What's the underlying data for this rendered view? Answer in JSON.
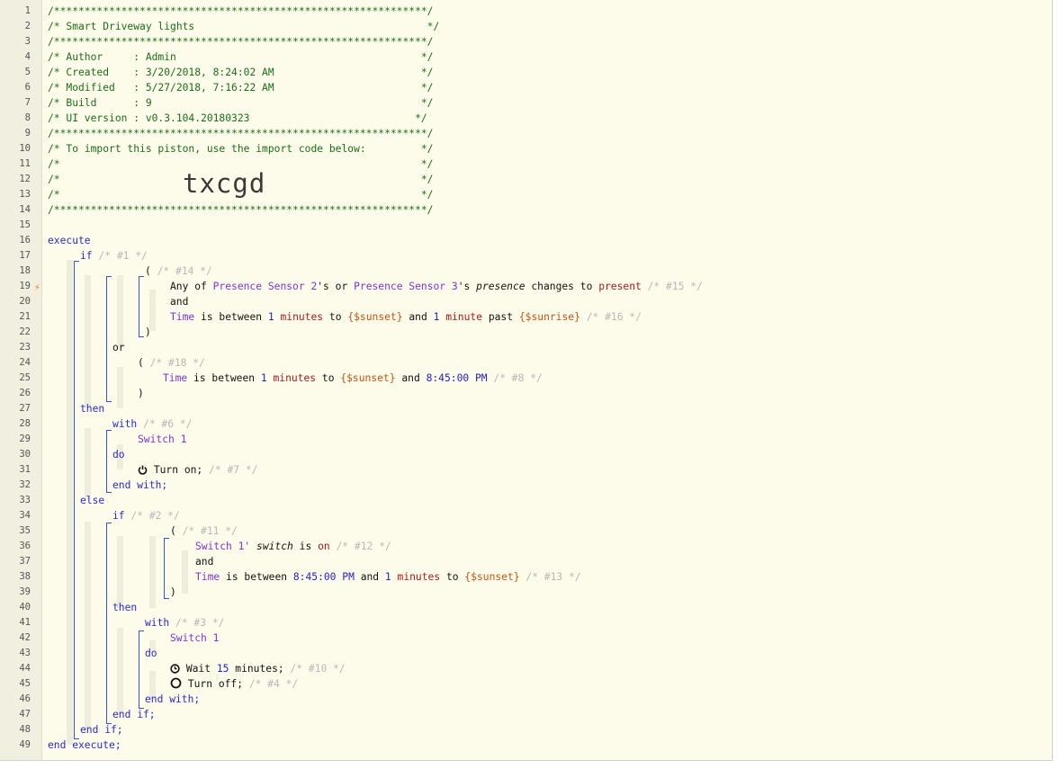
{
  "gutter": {
    "line_numbers": [
      "1",
      "2",
      "3",
      "4",
      "5",
      "6",
      "7",
      "8",
      "9",
      "10",
      "11",
      "12",
      "13",
      "14",
      "15",
      "16",
      "17",
      "18",
      "19",
      "20",
      "21",
      "22",
      "23",
      "24",
      "25",
      "26",
      "27",
      "28",
      "29",
      "30",
      "31",
      "32",
      "33",
      "34",
      "35",
      "36",
      "37",
      "38",
      "39",
      "40",
      "41",
      "42",
      "43",
      "44",
      "45",
      "46",
      "47",
      "48",
      "49"
    ],
    "trigger_marker": "lightning-bolt-icon"
  },
  "header": {
    "rule": "/*************************************************************/",
    "title": "/* Smart Driveway lights                                      */",
    "author": "/* Author     : Admin                                        */",
    "created": "/* Created    : 3/20/2018, 8:24:02 AM                        */",
    "modified": "/* Modified   : 5/27/2018, 7:16:22 AM                        */",
    "build": "/* Build      : 9                                            */",
    "ui_version": "/* UI version : v0.3.104.20180323                           */",
    "import_note": "/* To import this piston, use the import code below:         */",
    "blank": "/*                                                           */",
    "import_code": "txcgd"
  },
  "code": {
    "execute": "execute",
    "end_execute": "end execute;",
    "if": "if",
    "then": "then",
    "else": "else",
    "or": "or",
    "and": "and",
    "with": "with",
    "do": "do",
    "end_with": "end with;",
    "end_if": "end if;",
    "open_paren": "(",
    "close_paren": ")",
    "any_of": "Any of",
    "presence_sensor_2": "Presence Sensor 2",
    "presence_sensor_3": "Presence Sensor 3",
    "possessive": "'s",
    "or_word": "or",
    "presence_attr": "presence",
    "changes_to": "changes to",
    "present": "present",
    "time": "Time",
    "is_between": "is between",
    "one": "1",
    "minutes": "minutes",
    "minute": "minute",
    "to": "to",
    "sunset": "{$sunset}",
    "sunrise": "{$sunrise}",
    "past": "past",
    "time_845": "8:45:00 PM",
    "switch_1": "Switch 1",
    "switch_1_possessive": "Switch 1'",
    "switch_attr": "switch",
    "is": "is",
    "on": "on",
    "turn_on": "Turn on;",
    "turn_off": "Turn off;",
    "wait": "Wait",
    "fifteen": "15",
    "minutes_semi": "minutes;",
    "c1": "/* #1 */",
    "c14": "/* #14 */",
    "c15": "/* #15 */",
    "c16": "/* #16 */",
    "c18": "/* #18 */",
    "c8": "/* #8 */",
    "c6": "/* #6 */",
    "c7": "/* #7 */",
    "c2": "/* #2 */",
    "c11": "/* #11 */",
    "c12": "/* #12 */",
    "c13": "/* #13 */",
    "c3": "/* #3 */",
    "c10": "/* #10 */",
    "c4": "/* #4 */"
  },
  "colors": {
    "background": "#fdfbe9",
    "header_comment": "#1a6e1a",
    "keyword": "#2a2ad4",
    "device": "#7b35e0",
    "value": "#b01919",
    "variable": "#c75512",
    "comment": "#b8b8b8"
  }
}
